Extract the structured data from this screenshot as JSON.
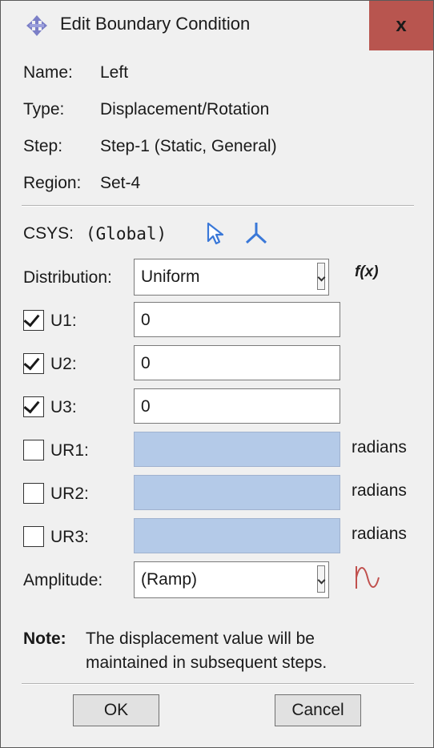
{
  "window": {
    "title": "Edit Boundary Condition",
    "close_label": "x"
  },
  "info": {
    "name_label": "Name:",
    "name_value": "Left",
    "type_label": "Type:",
    "type_value": "Displacement/Rotation",
    "step_label": "Step:",
    "step_value": "Step-1 (Static, General)",
    "region_label": "Region:",
    "region_value": "Set-4"
  },
  "csys": {
    "label": "CSYS:",
    "value": "(Global)"
  },
  "distribution": {
    "label": "Distribution:",
    "selected": "Uniform",
    "fx_label": "f(x)"
  },
  "dofs": [
    {
      "label": "U1:",
      "checked": true,
      "value": "0",
      "unit": ""
    },
    {
      "label": "U2:",
      "checked": true,
      "value": "0",
      "unit": ""
    },
    {
      "label": "U3:",
      "checked": true,
      "value": "0",
      "unit": ""
    },
    {
      "label": "UR1:",
      "checked": false,
      "value": "",
      "unit": "radians"
    },
    {
      "label": "UR2:",
      "checked": false,
      "value": "",
      "unit": "radians"
    },
    {
      "label": "UR3:",
      "checked": false,
      "value": "",
      "unit": "radians"
    }
  ],
  "amplitude": {
    "label": "Amplitude:",
    "selected": "(Ramp)"
  },
  "note": {
    "label": "Note:",
    "line1": "The displacement value will be",
    "line2": "maintained in subsequent steps."
  },
  "buttons": {
    "ok": "OK",
    "cancel": "Cancel"
  },
  "colors": {
    "close_bg": "#b8554f",
    "disabled_field": "#b4cae8",
    "accent_blue": "#3a78d8",
    "amplitude_icon": "#c0504d"
  },
  "icons": {
    "app": "diamond-arrows-icon",
    "select": "pointer-select-icon",
    "csys": "axis-triad-icon",
    "amplitude": "sine-wave-icon"
  }
}
